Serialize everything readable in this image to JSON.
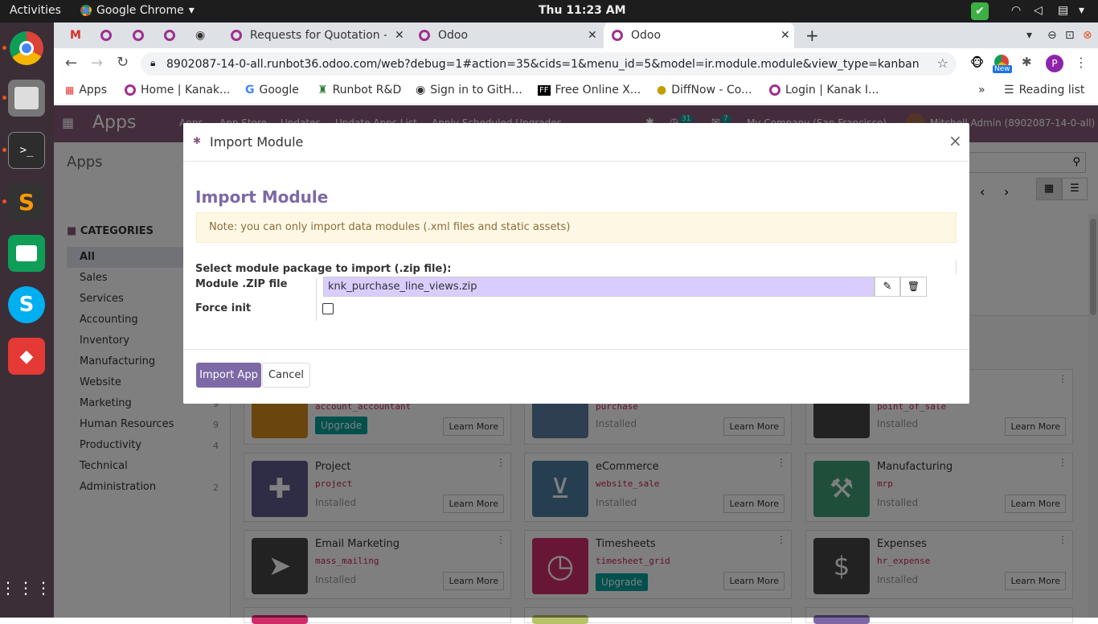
{
  "topbar": {
    "activities": "Activities",
    "app_name": "Google Chrome",
    "clock": "Thu 11:23 AM"
  },
  "tabs": {
    "tab1": "Requests for Quotation - :",
    "tab2": "Odoo",
    "tab3": "Odoo"
  },
  "address": {
    "url": "8902087-14-0-all.runbot36.odoo.com/web?debug=1#action=35&cids=1&menu_id=5&model=ir.module.module&view_type=kanban",
    "new_badge": "New",
    "profile": "P"
  },
  "bookmarks": {
    "apps": "Apps",
    "b1": "Home | Kanak...",
    "b2": "Google",
    "b3": "Runbot R&D",
    "b4": "Sign in to GitH...",
    "b5": "Free Online X...",
    "b6": "DiffNow - Co...",
    "b7": "Login | Kanak I...",
    "more": "»",
    "reading_list": "Reading list"
  },
  "odoo_nav": {
    "brand": "Apps",
    "menu": [
      "Apps",
      "App Store",
      "Updates",
      "Update Apps List",
      "Apply Scheduled Upgrades"
    ],
    "activity_count": "31",
    "message_count": "7",
    "company": "My Company (San Francisco)",
    "user": "Mitchell Admin (8902087-14-0-all)"
  },
  "control_panel": {
    "breadcrumb": "Apps"
  },
  "sidebar": {
    "heading": "CATEGORIES",
    "items": [
      {
        "label": "All",
        "count": ""
      },
      {
        "label": "Sales",
        "count": ""
      },
      {
        "label": "Services",
        "count": ""
      },
      {
        "label": "Accounting",
        "count": ""
      },
      {
        "label": "Inventory",
        "count": ""
      },
      {
        "label": "Manufacturing",
        "count": ""
      },
      {
        "label": "Website",
        "count": ""
      },
      {
        "label": "Marketing",
        "count": "9"
      },
      {
        "label": "Human Resources",
        "count": "9"
      },
      {
        "label": "Productivity",
        "count": "4"
      },
      {
        "label": "Technical",
        "count": ""
      },
      {
        "label": "Administration",
        "count": "2"
      }
    ]
  },
  "cards": {
    "learn_more": "Learn More",
    "upgrade": "Upgrade",
    "r1": [
      {
        "tech": "account_accountant",
        "status": "Upgrade"
      },
      {
        "tech": "purchase",
        "status": "Installed"
      },
      {
        "tech": "point_of_sale",
        "status": "Installed"
      }
    ],
    "r2": [
      {
        "name": "Project",
        "tech": "project",
        "status": "Installed",
        "color": "#5f5a8c"
      },
      {
        "name": "eCommerce",
        "tech": "website_sale",
        "status": "Installed",
        "color": "#4b7ea3"
      },
      {
        "name": "Manufacturing",
        "tech": "mrp",
        "status": "Installed",
        "color": "#3f9e76"
      }
    ],
    "r3": [
      {
        "name": "Email Marketing",
        "tech": "mass_mailing",
        "status": "Installed",
        "color": "#444"
      },
      {
        "name": "Timesheets",
        "tech": "timesheet_grid",
        "status": "Upgrade",
        "color": "#d12c6a"
      },
      {
        "name": "Expenses",
        "tech": "hr_expense",
        "status": "Installed",
        "color": "#444"
      }
    ]
  },
  "modal": {
    "title": "Import Module",
    "heading": "Import Module",
    "note": "Note: you can only import data modules (.xml files and static assets)",
    "select_label": "Select module package to import (.zip file):",
    "zip_label": "Module .ZIP file",
    "zip_value": "knk_purchase_line_views.zip",
    "force_label": "Force init",
    "import_btn": "Import App",
    "cancel_btn": "Cancel",
    "close": "×"
  },
  "colors": {
    "odoo_purple": "#875a7b",
    "heading_purple": "#7c69a5",
    "note_bg": "#fcf8e3",
    "file_bg": "#d9cdff"
  }
}
